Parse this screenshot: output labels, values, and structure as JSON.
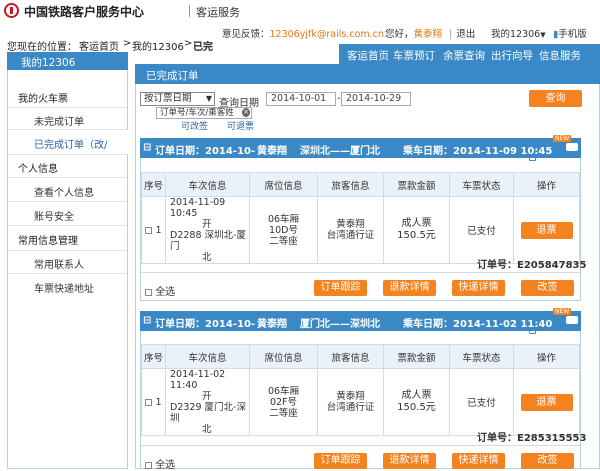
{
  "header": {
    "site_name": "中国铁路客户服务中心",
    "section": "客运服务",
    "feedback_label": "意见反馈：",
    "feedback_email": "12306yjfk@rails.com.cn",
    "greeting": "您好，",
    "user": "黄泰翔",
    "sep": "|",
    "logout": "退出",
    "my_menu": "我的12306",
    "mobile": "手机版"
  },
  "breadcrumb": {
    "prefix": "您现在的位置：",
    "home": "客运首页",
    "sep1": ">",
    "my": "我的12306",
    "sep2": ">",
    "current": "已完"
  },
  "nav": [
    "客运首页",
    "车票预订",
    "余票查询",
    "出行向导",
    "信息服务"
  ],
  "sidebar": {
    "title": "我的12306",
    "group1": "我的火车票",
    "items1": [
      "未完成订单",
      "已完成订单（改/"
    ],
    "group2": "个人信息",
    "items2": [
      "查看个人信息",
      "账号安全"
    ],
    "group3": "常用信息管理",
    "items3": [
      "常用联系人",
      "车票快递地址"
    ]
  },
  "main": {
    "tab": "已完成订单",
    "filter_select": "按订票日期",
    "date_label": "查询日期",
    "date_from": "2014-10-01",
    "date_dash": "-",
    "date_to": "2014-10-29",
    "query_button": "查询",
    "hint_placeholder": "订单号/车次/乘客姓",
    "hint_link1": "可改签",
    "hint_link2": "可退票"
  },
  "table_headers": [
    "序号",
    "车次信息",
    "席位信息",
    "旅客信息",
    "票款金额",
    "车票状态",
    "操作"
  ],
  "orders": [
    {
      "head_date": "订单日期：2014-10-",
      "head_name": "黄泰翔",
      "head_route": "深圳北——厦门北",
      "head_ride": "乘车日期：2014-11-09 10:45",
      "new_tag": "NEW",
      "index": "1",
      "time": "2014-11-09 10:45",
      "kai": "开",
      "train": "D2288",
      "route": "深圳北-厦门",
      "route2": "北",
      "seat1": "06车厢",
      "seat2": "10D号",
      "seat3": "二等座",
      "pax_name": "黄泰翔",
      "pax_id": "台湾通行证",
      "ticket_type": "成人票",
      "price": "150.5元",
      "status": "已支付",
      "refund": "退票",
      "order_no_label": "订单号：",
      "order_no": "E205847835",
      "select_all": "全选",
      "actions": [
        "订单跟踪",
        "退款详情",
        "快递详情",
        "改签"
      ]
    },
    {
      "head_date": "订单日期：2014-10-",
      "head_name": "黄泰翔",
      "head_route": "厦门北——深圳北",
      "head_ride": "乘车日期：2014-11-02 11:40",
      "new_tag": "NEW",
      "index": "1",
      "time": "2014-11-02 11:40",
      "kai": "开",
      "train": "D2329",
      "route": "厦门北-深圳",
      "route2": "北",
      "seat1": "06车厢",
      "seat2": "02F号",
      "seat3": "二等座",
      "pax_name": "黄泰翔",
      "pax_id": "台湾通行证",
      "ticket_type": "成人票",
      "price": "150.5元",
      "status": "已支付",
      "refund": "退票",
      "order_no_label": "订单号：",
      "order_no": "E285315553",
      "select_all": "全选",
      "actions": [
        "订单跟踪",
        "退款详情",
        "快递详情",
        "改签"
      ]
    }
  ]
}
